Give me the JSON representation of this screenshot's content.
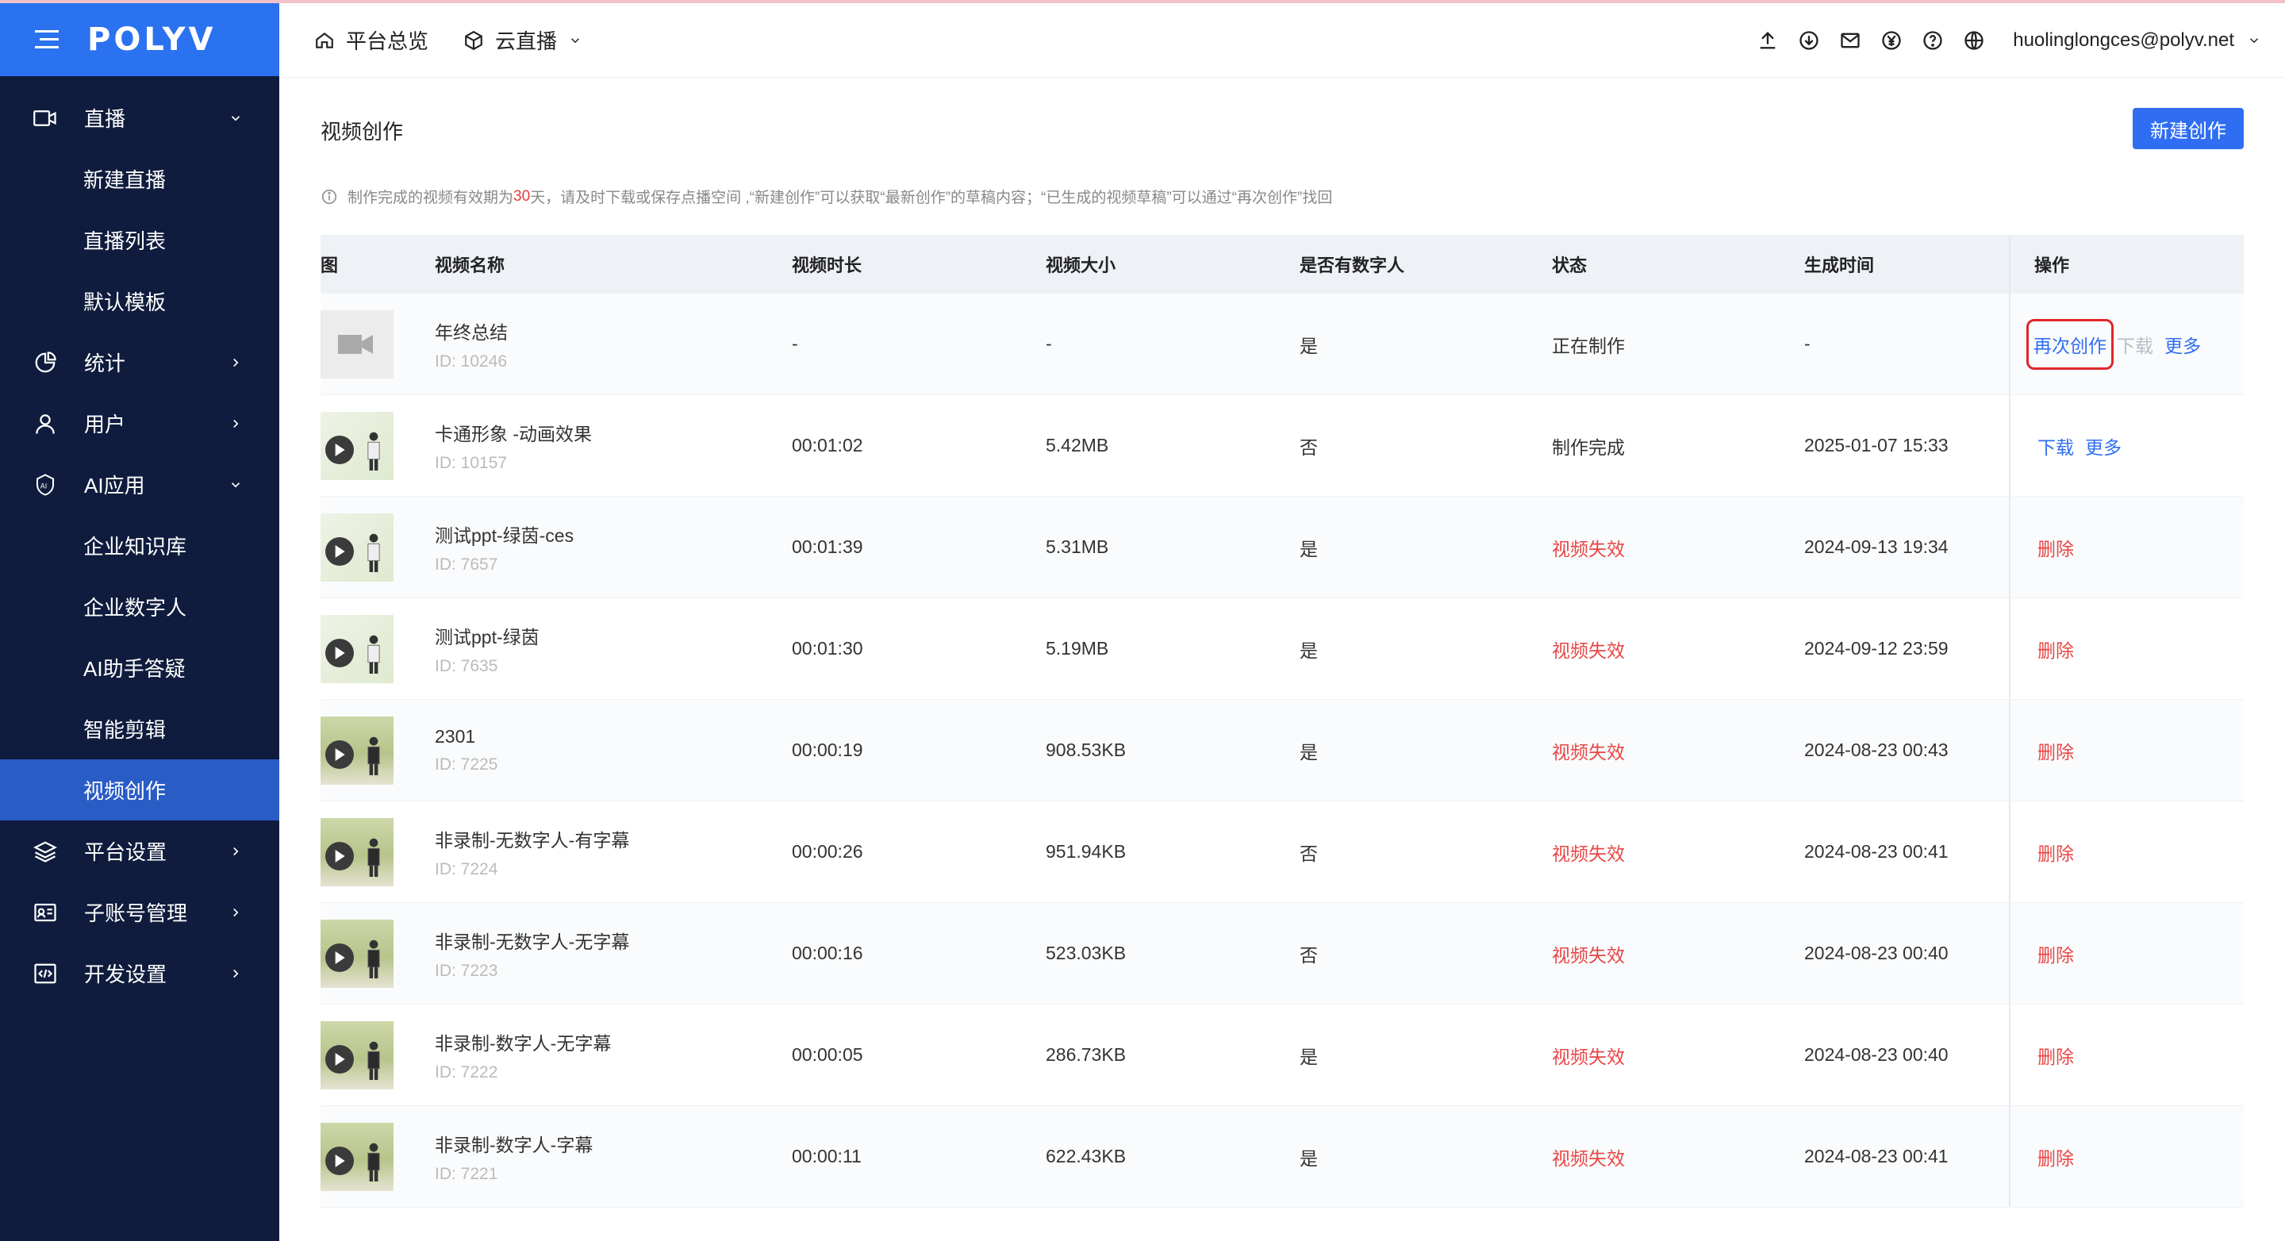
{
  "app": {
    "logo": "POLYV",
    "topbar": {
      "overview": "平台总览",
      "product": "云直播",
      "user": "huolinglongces@polyv.net"
    }
  },
  "sidebar": {
    "items": [
      {
        "label": "直播",
        "type": "top",
        "icon": "video-icon",
        "chevron": "down"
      },
      {
        "label": "新建直播",
        "type": "sub"
      },
      {
        "label": "直播列表",
        "type": "sub"
      },
      {
        "label": "默认模板",
        "type": "sub"
      },
      {
        "label": "统计",
        "type": "top",
        "icon": "pie-chart-icon",
        "chevron": "right"
      },
      {
        "label": "用户",
        "type": "top",
        "icon": "user-icon",
        "chevron": "right"
      },
      {
        "label": "AI应用",
        "type": "top",
        "icon": "ai-shield-icon",
        "chevron": "down"
      },
      {
        "label": "企业知识库",
        "type": "sub"
      },
      {
        "label": "企业数字人",
        "type": "sub"
      },
      {
        "label": "AI助手答疑",
        "type": "sub"
      },
      {
        "label": "智能剪辑",
        "type": "sub"
      },
      {
        "label": "视频创作",
        "type": "sub",
        "active": true
      },
      {
        "label": "平台设置",
        "type": "top",
        "icon": "layers-icon",
        "chevron": "right"
      },
      {
        "label": "子账号管理",
        "type": "top",
        "icon": "id-card-icon",
        "chevron": "right"
      },
      {
        "label": "开发设置",
        "type": "top",
        "icon": "code-icon",
        "chevron": "right"
      }
    ]
  },
  "page": {
    "title": "视频创作",
    "new_button": "新建创作",
    "tip_before": "制作完成的视频有效期为",
    "tip_days": "30",
    "tip_after": "天，请及时下载或保存点播空间 ,“新建创作”可以获取“最新创作”的草稿内容；“已生成的视频草稿”可以通过“再次创作”找回"
  },
  "table": {
    "headers": {
      "img": "图",
      "name": "视频名称",
      "duration": "视频时长",
      "size": "视频大小",
      "digital_human": "是否有数字人",
      "status": "状态",
      "time": "生成时间",
      "ops": "操作"
    },
    "rows": [
      {
        "name": "年终总结",
        "id": "ID: 10246",
        "duration": "-",
        "size": "-",
        "dh": "是",
        "status": "正在制作",
        "time": "-",
        "ops": [
          "再次创作",
          "下载",
          "更多"
        ],
        "thumb": "cam"
      },
      {
        "name": "卡通形象 -动画效果",
        "id": "ID: 10157",
        "duration": "00:01:02",
        "size": "5.42MB",
        "dh": "否",
        "status": "制作完成",
        "time": "2025-01-07 15:33",
        "ops": [
          "下载",
          "更多"
        ],
        "thumb": "green"
      },
      {
        "name": "测试ppt-绿茵-ces",
        "id": "ID: 7657",
        "duration": "00:01:39",
        "size": "5.31MB",
        "dh": "是",
        "status": "视频失效",
        "time": "2024-09-13 19:34",
        "ops": [
          "删除"
        ],
        "thumb": "green"
      },
      {
        "name": "测试ppt-绿茵",
        "id": "ID: 7635",
        "duration": "00:01:30",
        "size": "5.19MB",
        "dh": "是",
        "status": "视频失效",
        "time": "2024-09-12 23:59",
        "ops": [
          "删除"
        ],
        "thumb": "green"
      },
      {
        "name": "2301",
        "id": "ID: 7225",
        "duration": "00:00:19",
        "size": "908.53KB",
        "dh": "是",
        "status": "视频失效",
        "time": "2024-08-23 00:43",
        "ops": [
          "删除"
        ],
        "thumb": "room"
      },
      {
        "name": "非录制-无数字人-有字幕",
        "id": "ID: 7224",
        "duration": "00:00:26",
        "size": "951.94KB",
        "dh": "否",
        "status": "视频失效",
        "time": "2024-08-23 00:41",
        "ops": [
          "删除"
        ],
        "thumb": "room"
      },
      {
        "name": "非录制-无数字人-无字幕",
        "id": "ID: 7223",
        "duration": "00:00:16",
        "size": "523.03KB",
        "dh": "否",
        "status": "视频失效",
        "time": "2024-08-23 00:40",
        "ops": [
          "删除"
        ],
        "thumb": "room"
      },
      {
        "name": "非录制-数字人-无字幕",
        "id": "ID: 7222",
        "duration": "00:00:05",
        "size": "286.73KB",
        "dh": "是",
        "status": "视频失效",
        "time": "2024-08-23 00:40",
        "ops": [
          "删除"
        ],
        "thumb": "room"
      },
      {
        "name": "非录制-数字人-字幕",
        "id": "ID: 7221",
        "duration": "00:00:11",
        "size": "622.43KB",
        "dh": "是",
        "status": "视频失效",
        "time": "2024-08-23 00:41",
        "ops": [
          "删除"
        ],
        "thumb": "room"
      }
    ]
  }
}
